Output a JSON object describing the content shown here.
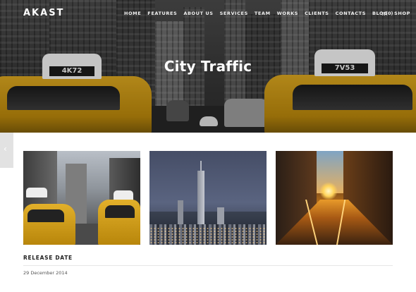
{
  "brand": {
    "logo": "AKAST"
  },
  "nav": {
    "items": [
      {
        "label": "HOME"
      },
      {
        "label": "FEATURES"
      },
      {
        "label": "ABOUT US"
      },
      {
        "label": "SERVICES"
      },
      {
        "label": "TEAM"
      },
      {
        "label": "WORKS"
      },
      {
        "label": "CLIENTS"
      },
      {
        "label": "CONTACTS"
      },
      {
        "label": "BLOG"
      },
      {
        "label": "SHOP"
      }
    ],
    "cart": {
      "count_label": "(0)",
      "icon": "cart-icon"
    }
  },
  "hero": {
    "title": "City Traffic",
    "taxi_left_plate": "4K72",
    "taxi_right_plate": "7V53",
    "accent_color": "#d9a520"
  },
  "side_tab": {
    "icon": "chevron-left-icon",
    "glyph": "‹"
  },
  "gallery": {
    "items": [
      {
        "name": "gallery-image-taxis"
      },
      {
        "name": "gallery-image-skyline"
      },
      {
        "name": "gallery-image-sunset-street"
      }
    ]
  },
  "release": {
    "label": "RELEASE DATE",
    "date": "29 December 2014"
  }
}
